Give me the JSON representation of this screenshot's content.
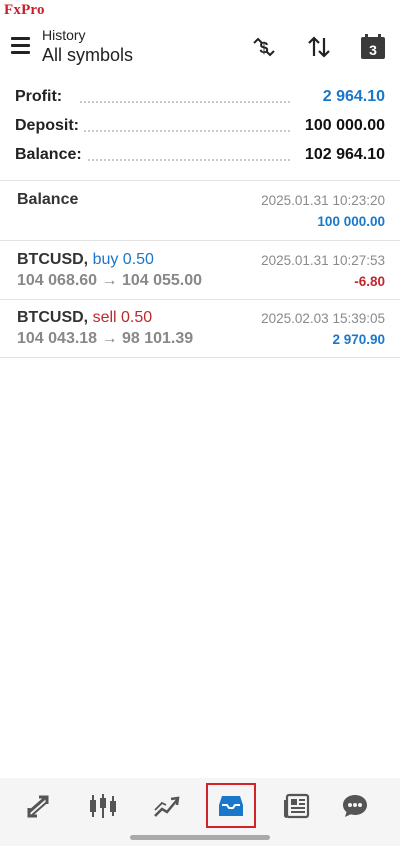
{
  "brand": "FxPro",
  "header": {
    "subtitle": "History",
    "title": "All symbols",
    "icons": [
      "menu-icon",
      "dollar-sync-icon",
      "sort-icon",
      "calendar-icon"
    ],
    "calendar_day": "3"
  },
  "summary": [
    {
      "label": "Profit:",
      "value": "2 964.10",
      "color": "#1a77c9"
    },
    {
      "label": "Deposit:",
      "value": "100 000.00",
      "color": "#111111"
    },
    {
      "label": "Balance:",
      "value": "102 964.10",
      "color": "#111111"
    }
  ],
  "entries": [
    {
      "title": "Balance",
      "time": "2025.01.31 10:23:20",
      "amount": "100 000.00",
      "amount_color": "#1a77c9"
    },
    {
      "symbol": "BTCUSD",
      "side": "buy 0.50",
      "side_color": "#1a77c9",
      "prices": "104 068.60 → 104 055.00",
      "time": "2025.01.31 10:27:53",
      "amount": "-6.80",
      "amount_color": "#c0282e"
    },
    {
      "symbol": "BTCUSD",
      "side": "sell 0.50",
      "side_color": "#c0282e",
      "prices": "104 043.18 → 98 101.39",
      "time": "2025.02.03 15:39:05",
      "amount": "2 970.90",
      "amount_color": "#1a77c9"
    }
  ],
  "bottom_nav": [
    {
      "icon": "quotes-icon",
      "active": false
    },
    {
      "icon": "chart-icon",
      "active": false
    },
    {
      "icon": "trade-icon",
      "active": false
    },
    {
      "icon": "history-icon",
      "active": true
    },
    {
      "icon": "news-icon",
      "active": false
    },
    {
      "icon": "messages-icon",
      "active": false
    }
  ],
  "colors": {
    "accent": "#1a77c9",
    "loss": "#c0282e",
    "active_outline": "#d2232a",
    "brand": "#c8202a"
  }
}
